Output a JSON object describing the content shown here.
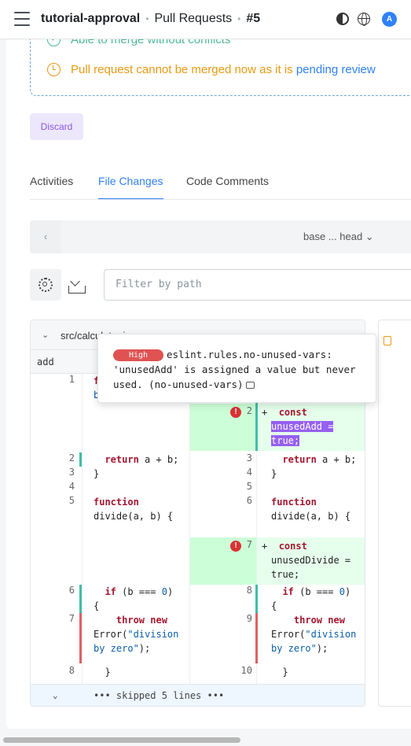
{
  "header": {
    "repo": "tutorial-approval",
    "section": "Pull Requests",
    "pr_number": "#5",
    "avatar_letter": "A",
    "icons": [
      "hamburger-icon",
      "contrast-icon",
      "globe-icon"
    ]
  },
  "merge_status": {
    "no_conflicts": "Able to merge without conflicts",
    "pending_prefix": "Pull request cannot be merged now as it is",
    "pending_link": "pending review",
    "colors": {
      "ok": "#4fb89a",
      "warn": "#e99a14",
      "link": "#2f81f7"
    }
  },
  "actions": {
    "discard": "Discard"
  },
  "tabs": [
    {
      "label": "Activities",
      "active": false
    },
    {
      "label": "File Changes",
      "active": true
    },
    {
      "label": "Code Comments",
      "active": false
    }
  ],
  "compare": {
    "prev": "‹",
    "label": "base ... head ⌄"
  },
  "filter": {
    "placeholder": "Filter by path"
  },
  "file": {
    "chevron": "⌄",
    "path": "src/calculator.js",
    "function_header": "add",
    "skipped": "••• skipped 5 lines •••",
    "skip_chevron": "⌄"
  },
  "tooltip": {
    "severity": "High",
    "line1": "eslint.rules.no-unused-vars:",
    "line2": "'unusedAdd' is assigned a value but never",
    "line3": "used. (no-unused-vars)"
  },
  "diff": {
    "left_nums": [
      "1",
      "2",
      "3",
      "4",
      "5",
      "6",
      "7",
      "8"
    ],
    "right_nums": [
      "2",
      "3",
      "4",
      "5",
      "6",
      "7",
      "8",
      "9",
      "10"
    ],
    "error_marker": "!",
    "plus": "+"
  }
}
